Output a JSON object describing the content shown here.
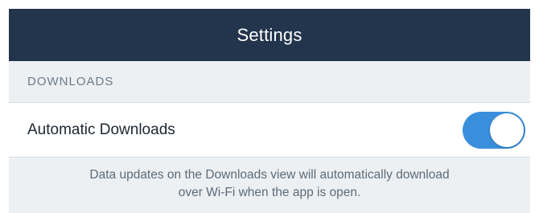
{
  "navbar": {
    "title": "Settings"
  },
  "downloads_section": {
    "header": "DOWNLOADS",
    "automatic_downloads": {
      "label": "Automatic Downloads",
      "enabled": true
    },
    "footer_lines": [
      "Data updates on the Downloads view will automatically download",
      "over Wi-Fi when the app is open."
    ]
  },
  "colors": {
    "navbar": "#23354c",
    "toggle_on": "#3a8fdc",
    "background": "#ecf0f3"
  }
}
